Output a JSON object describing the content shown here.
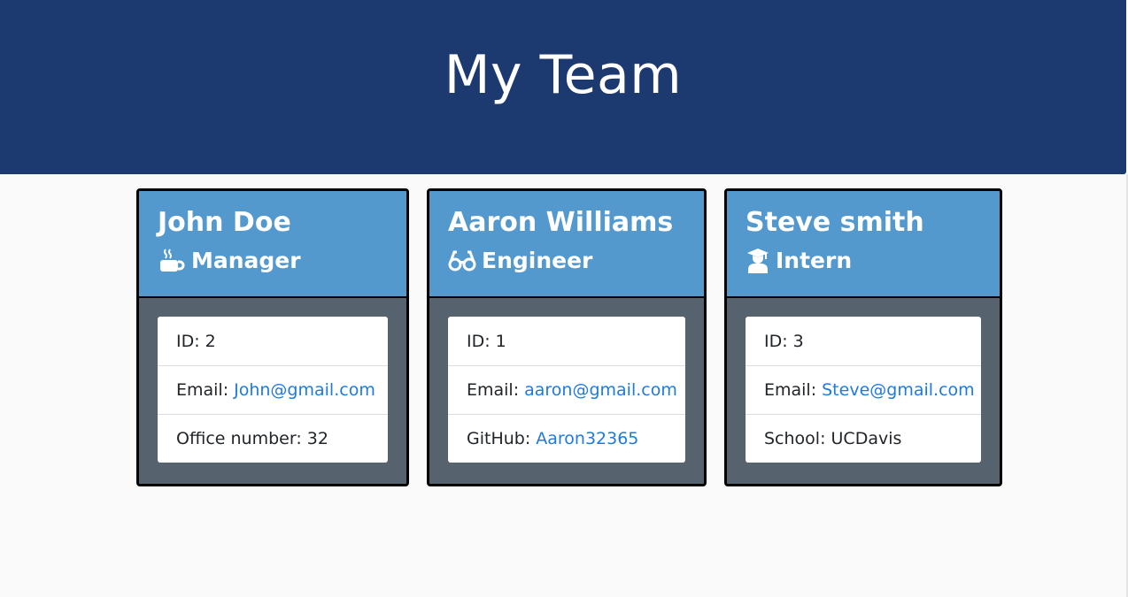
{
  "header": {
    "title": "My Team"
  },
  "colors": {
    "header_bg": "#1d3a70",
    "card_head_bg": "#5499cd",
    "card_body_bg": "#56626d",
    "link": "#1f7ae0"
  },
  "cards": [
    {
      "name": "John Doe",
      "role": "Manager",
      "icon": "coffee-icon",
      "id_text": "ID: 2",
      "email_label": "Email:",
      "email": "John@gmail.com",
      "extra_label": "Office number: 32",
      "extra_link": ""
    },
    {
      "name": "Aaron Williams",
      "role": "Engineer",
      "icon": "glasses-icon",
      "id_text": "ID: 1",
      "email_label": "Email:",
      "email": "aaron@gmail.com",
      "extra_label": "GitHub:",
      "extra_link": "Aaron32365"
    },
    {
      "name": "Steve smith",
      "role": "Intern",
      "icon": "graduate-icon",
      "id_text": "ID: 3",
      "email_label": "Email:",
      "email": "Steve@gmail.com",
      "extra_label": "School: UCDavis",
      "extra_link": ""
    }
  ]
}
